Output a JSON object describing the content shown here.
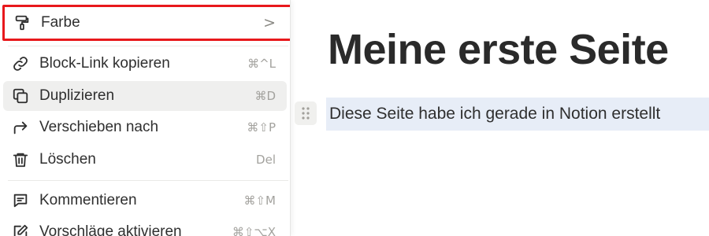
{
  "menu": {
    "color": {
      "label": "Farbe",
      "chevron": ">"
    },
    "items": [
      {
        "label": "Block-Link kopieren",
        "shortcut": "⌘^L",
        "icon": "link-icon"
      },
      {
        "label": "Duplizieren",
        "shortcut": "⌘D",
        "icon": "duplicate-icon"
      },
      {
        "label": "Verschieben nach",
        "shortcut": "⌘⇧P",
        "icon": "move-arrow-icon"
      },
      {
        "label": "Löschen",
        "shortcut": "Del",
        "icon": "trash-icon"
      },
      {
        "label": "Kommentieren",
        "shortcut": "⌘⇧M",
        "icon": "comment-icon"
      },
      {
        "label": "Vorschläge aktivieren",
        "shortcut": "⌘⇧⌥X",
        "icon": "suggest-edit-icon"
      }
    ]
  },
  "page": {
    "title": "Meine erste Seite",
    "block_text": "Diese Seite habe ich gerade in Notion erstellt"
  },
  "colors": {
    "highlight_border": "#e8181c",
    "selected_block": "#e7edf7",
    "hover_item": "#efefee"
  }
}
